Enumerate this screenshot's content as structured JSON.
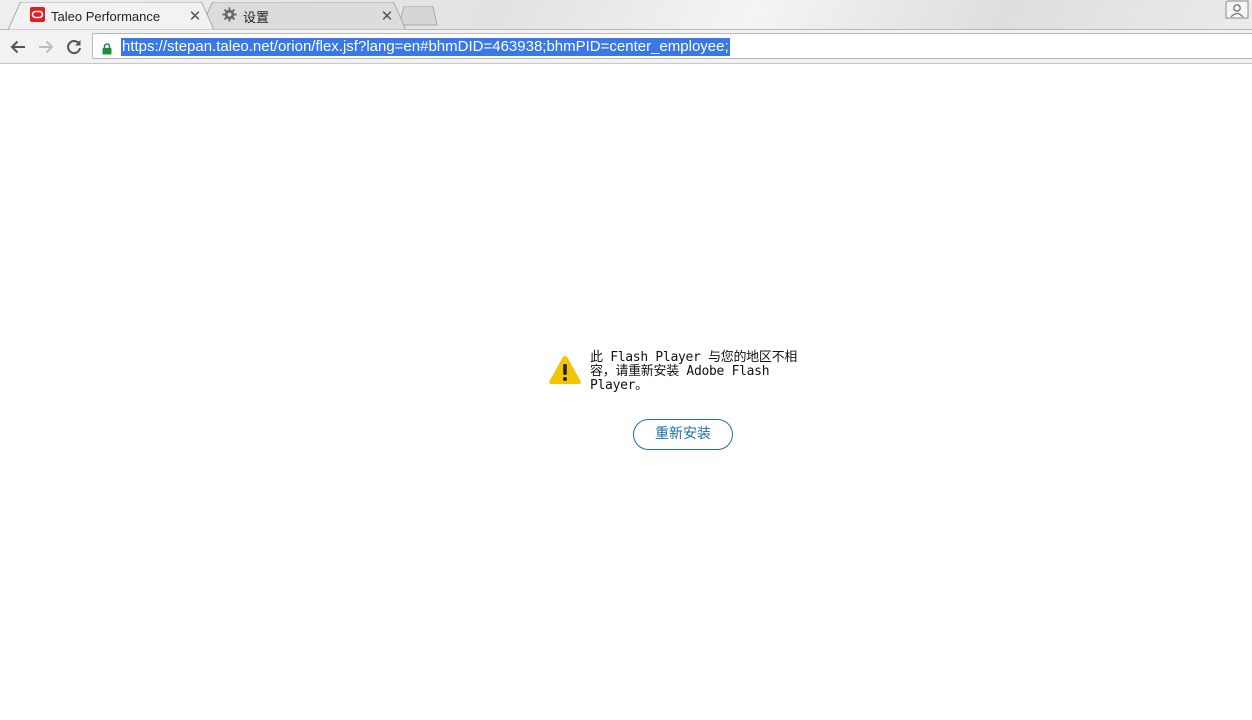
{
  "browser": {
    "tabs": [
      {
        "title": "Taleo Performance",
        "icon": "oracle-logo-icon",
        "active": true
      },
      {
        "title": "设置",
        "icon": "gear-icon",
        "active": false
      }
    ],
    "address_bar": {
      "url": "https://stepan.taleo.net/orion/flex.jsf?lang=en#bhmDID=463938;bhmPID=center_employee;",
      "secure": true
    }
  },
  "content": {
    "message": "此 Flash Player 与您的地区不相容，请重新安装 Adobe Flash Player。",
    "button_label": "重新安装"
  },
  "colors": {
    "selection": "#3b78e7",
    "warning_icon": "#f5c400",
    "button_accent": "#1f6fa8",
    "secure_lock": "#1e8e3e",
    "oracle_red": "#e02020"
  }
}
